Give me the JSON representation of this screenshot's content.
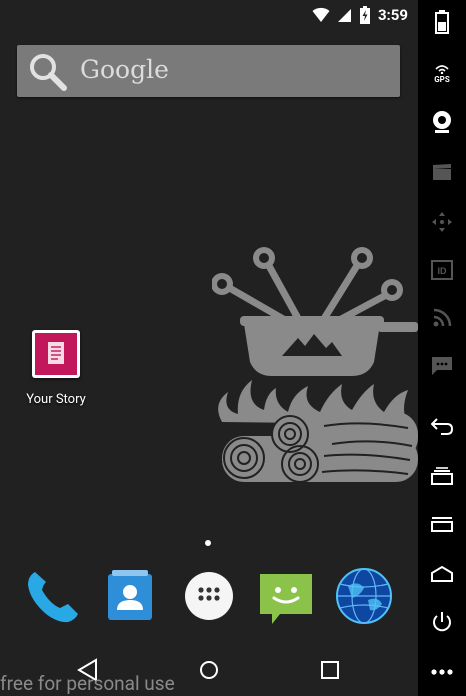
{
  "status_bar": {
    "time": "3:59"
  },
  "search_bar": {
    "label": "Google"
  },
  "home_apps": [
    {
      "label": "Your Story"
    }
  ],
  "dock": {
    "items": [
      "phone",
      "contacts",
      "app-drawer",
      "messaging",
      "browser"
    ]
  },
  "watermark": "free for personal use",
  "sidebar": {
    "gps_label": "GPS"
  },
  "colors": {
    "screen_bg": "#212121",
    "search_bg": "#7a7a7a",
    "wallpaper_art": "#8a8a8a",
    "your_story_icon": "#c2185b",
    "phone_icon": "#29a8e6",
    "contacts_icon": "#2e8ed8",
    "messaging_icon": "#8bc34a",
    "sidebar_bg": "#000000"
  }
}
